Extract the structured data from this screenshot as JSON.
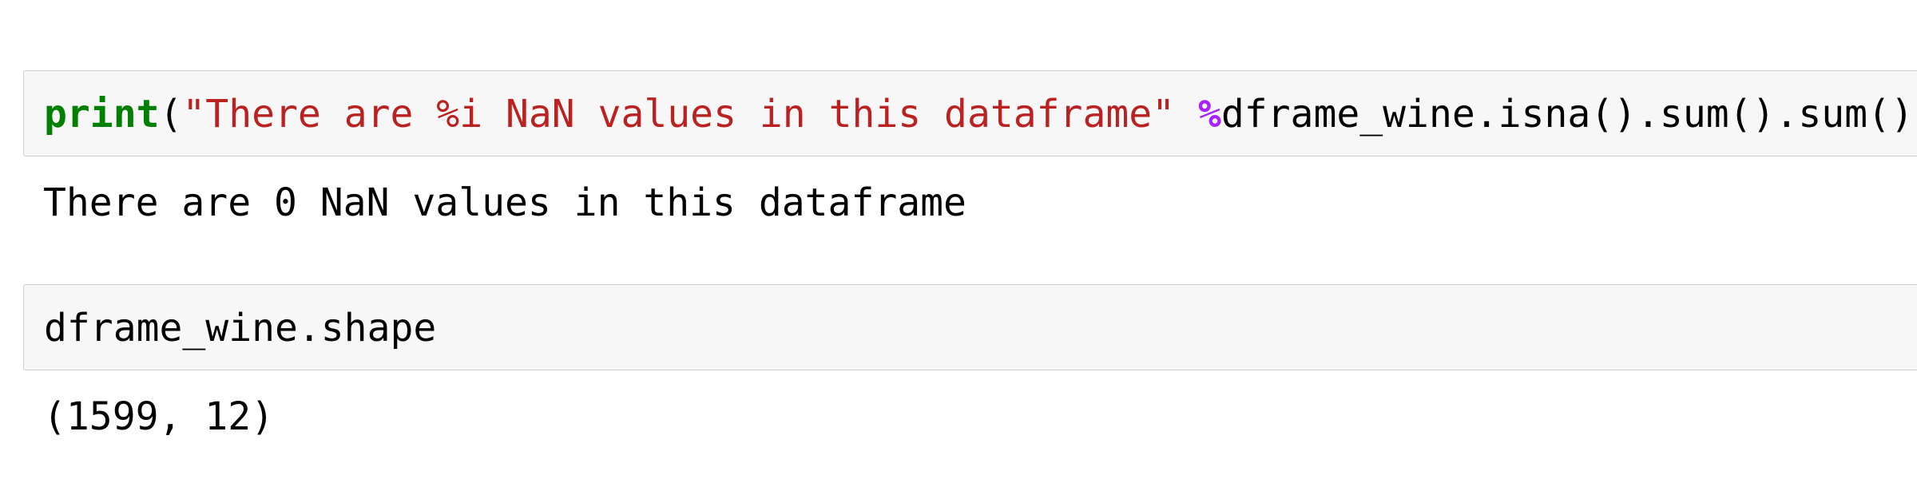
{
  "cells": [
    {
      "code": {
        "builtin": "print",
        "open_paren": "(",
        "string": "\"There are %i NaN values in this dataframe\"",
        "space": " ",
        "operator": "%",
        "expression": "dframe_wine.isna().sum().sum())"
      },
      "output": "There are 0 NaN values in this dataframe"
    },
    {
      "code": {
        "text": "dframe_wine.shape"
      },
      "output": "(1599, 12)"
    }
  ],
  "colors": {
    "builtin": "#008000",
    "string": "#ba2121",
    "operator": "#aa22ff",
    "cell_background": "#f7f7f7",
    "cell_border": "#cfcfcf"
  }
}
